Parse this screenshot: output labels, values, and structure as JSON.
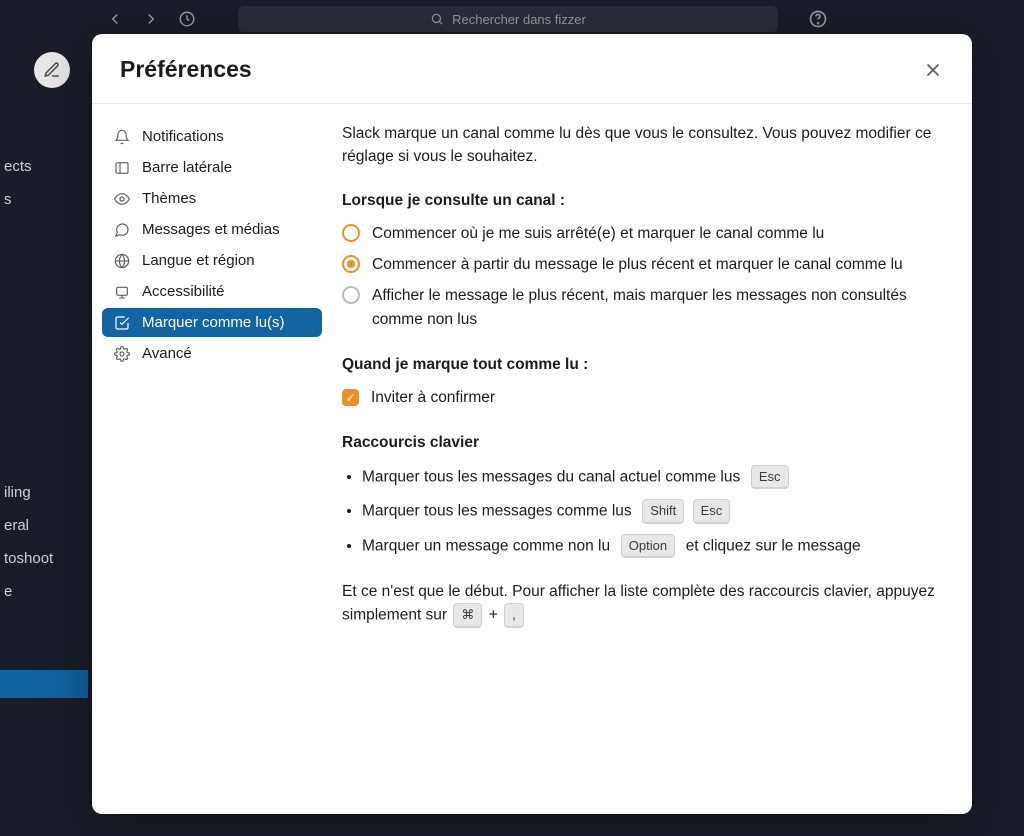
{
  "topbar": {
    "search_placeholder": "Rechercher dans fizzer"
  },
  "bg_sidebar": [
    "ects",
    "s",
    "iling",
    "eral",
    "toshoot",
    "e"
  ],
  "modal": {
    "title": "Préférences",
    "sidebar": [
      {
        "icon": "bell",
        "label": "Notifications"
      },
      {
        "icon": "sidebar",
        "label": "Barre latérale"
      },
      {
        "icon": "theme",
        "label": "Thèmes"
      },
      {
        "icon": "message",
        "label": "Messages et médias"
      },
      {
        "icon": "globe",
        "label": "Langue et région"
      },
      {
        "icon": "access",
        "label": "Accessibilité"
      },
      {
        "icon": "check",
        "label": "Marquer comme lu(s)"
      },
      {
        "icon": "gear",
        "label": "Avancé"
      }
    ],
    "active_index": 6,
    "content": {
      "intro": "Slack marque un canal comme lu dès que vous le consultez. Vous pouvez modifier ce réglage si vous le souhaitez.",
      "when_viewing_heading": "Lorsque je consulte un canal :",
      "radios": [
        "Commencer où je me suis arrêté(e) et marquer le canal comme lu",
        "Commencer à partir du message le plus récent et marquer le canal comme lu",
        "Afficher le message le plus récent, mais marquer les messages non consultés comme non lus"
      ],
      "selected_radio": 1,
      "highlight_radio": 0,
      "mark_all_heading": "Quand je marque tout comme lu :",
      "confirm_label": "Inviter à confirmer",
      "confirm_checked": true,
      "shortcuts_heading": "Raccourcis clavier",
      "shortcuts": [
        {
          "text": "Marquer tous les messages du canal actuel comme lus",
          "keys": [
            "Esc"
          ]
        },
        {
          "text": "Marquer tous les messages comme lus",
          "keys": [
            "Shift",
            "Esc"
          ]
        },
        {
          "text": "Marquer un message comme non lu",
          "keys": [
            "Option"
          ],
          "suffix": "et cliquez sur le message"
        }
      ],
      "footer_prefix": "Et ce n'est que le début. Pour afficher la liste complète des raccourcis clavier, appuyez simplement sur",
      "footer_keys": [
        "⌘",
        ","
      ],
      "plus": "+"
    }
  }
}
